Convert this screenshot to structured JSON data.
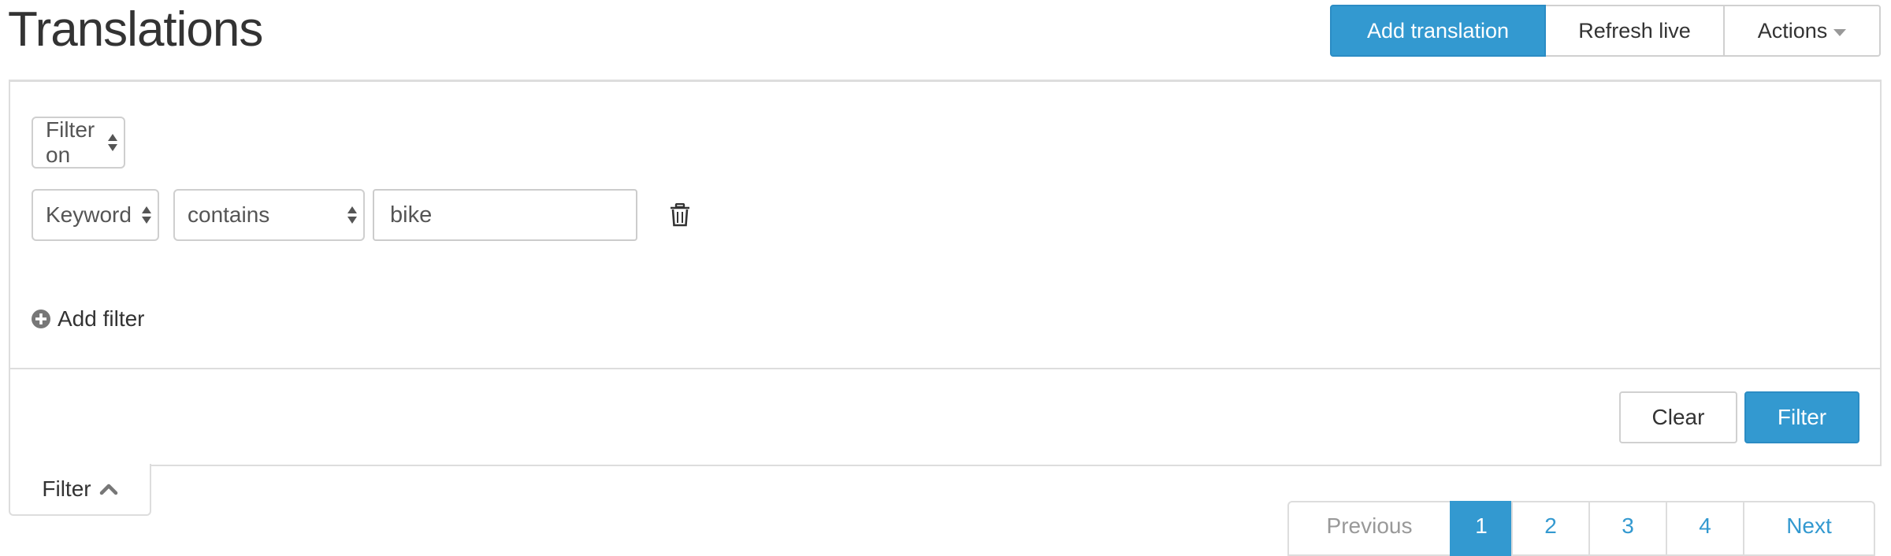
{
  "page": {
    "title": "Translations"
  },
  "header_actions": {
    "add_label": "Add translation",
    "refresh_label": "Refresh live",
    "actions_label": "Actions"
  },
  "filter_panel": {
    "filter_on_label": "Filter on",
    "filter_row": {
      "field": "Keyword",
      "operator": "contains",
      "value": "bike"
    },
    "add_filter_label": "Add filter",
    "clear_label": "Clear",
    "filter_label": "Filter"
  },
  "filter_toggle": {
    "label": "Filter"
  },
  "pagination": {
    "previous": "Previous",
    "pages": [
      "1",
      "2",
      "3",
      "4"
    ],
    "active_page": "1",
    "next": "Next"
  },
  "colors": {
    "primary": "#3399d0",
    "border": "#dddddd",
    "text": "#333333"
  }
}
